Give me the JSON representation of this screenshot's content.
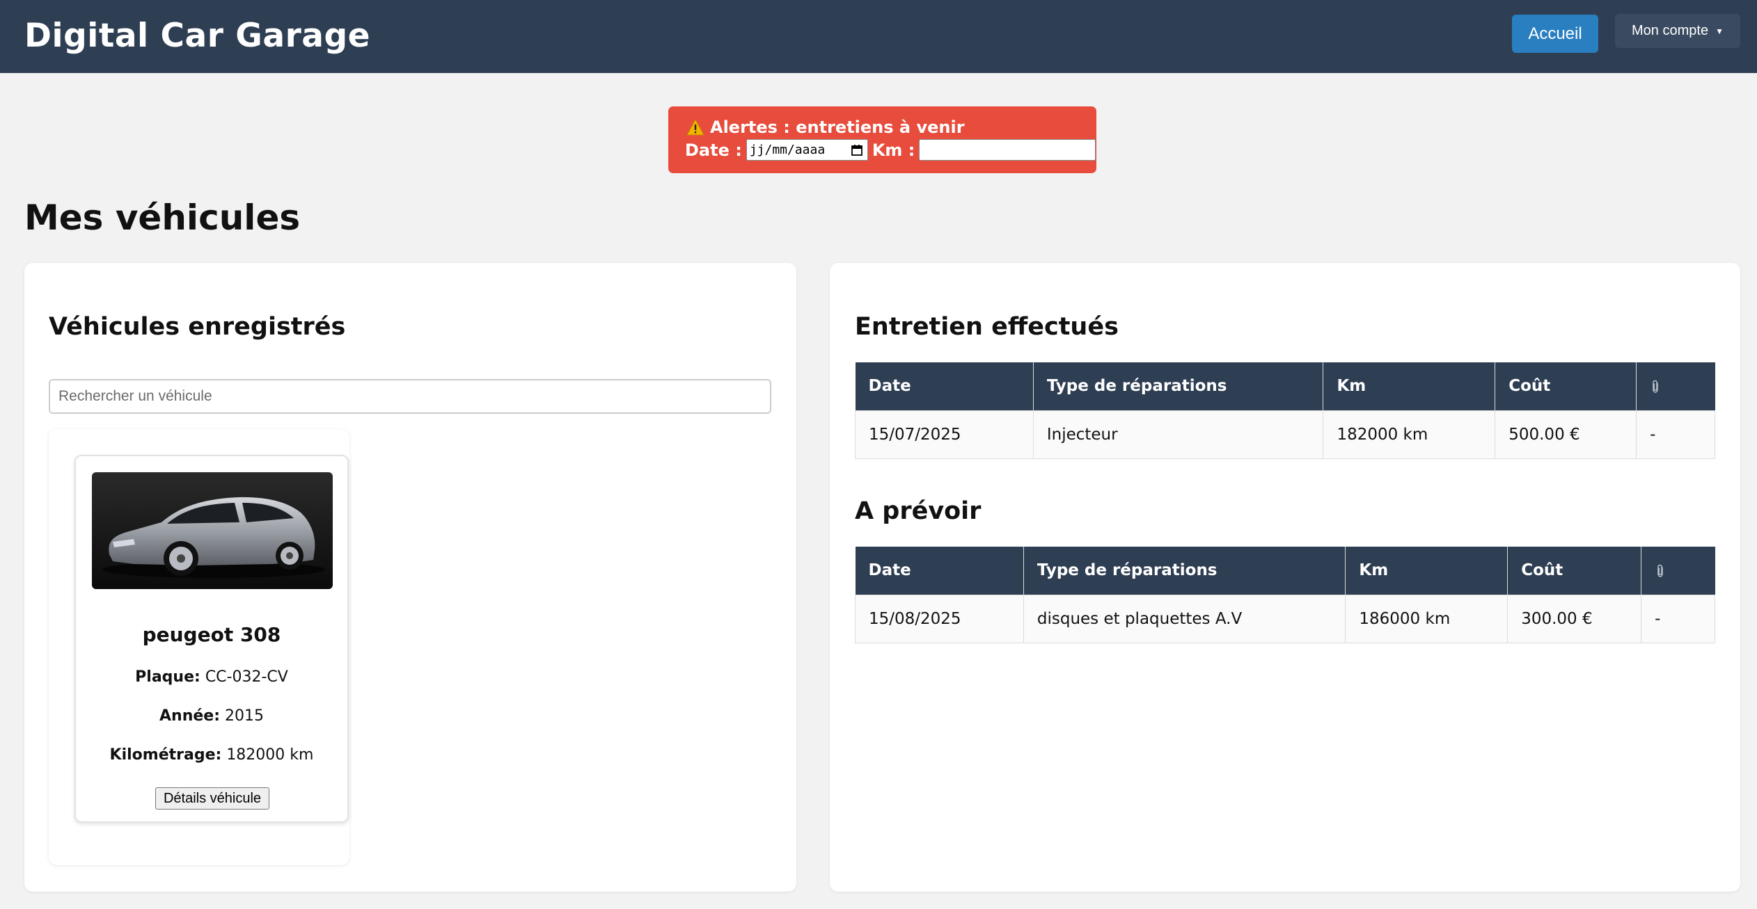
{
  "header": {
    "brand": "Digital Car Garage",
    "home_label": "Accueil",
    "account_label": "Mon compte"
  },
  "alert": {
    "title": "Alertes : entretiens à venir",
    "date_label": "Date :",
    "date_placeholder": "jj/mm/aaaa",
    "km_label": "Km :",
    "km_value": ""
  },
  "page_title": "Mes véhicules",
  "vehicles": {
    "heading": "Véhicules enregistrés",
    "search_placeholder": "Rechercher un véhicule",
    "items": [
      {
        "name": "peugeot 308",
        "plate_label": "Plaque:",
        "plate": "CC-032-CV",
        "year_label": "Année:",
        "year": "2015",
        "km_label": "Kilométrage:",
        "km": "182000 km",
        "details_label": "Détails véhicule"
      }
    ]
  },
  "maintenance_done": {
    "heading": "Entretien effectués",
    "columns": [
      "Date",
      "Type de réparations",
      "Km",
      "Coût"
    ],
    "attachment_icon": "paperclip-icon",
    "rows": [
      {
        "date": "15/07/2025",
        "type": "Injecteur",
        "km": "182000 km",
        "cost": "500.00 €",
        "attachment": "-"
      }
    ]
  },
  "maintenance_planned": {
    "heading": "A prévoir",
    "columns": [
      "Date",
      "Type de réparations",
      "Km",
      "Coût"
    ],
    "attachment_icon": "paperclip-icon",
    "rows": [
      {
        "date": "15/08/2025",
        "type": "disques et plaquettes A.V",
        "km": "186000 km",
        "cost": "300.00 €",
        "attachment": "-"
      }
    ]
  },
  "colors": {
    "header_bg": "#2e3e53",
    "primary_button": "#2a7fc1",
    "alert_bg": "#e74c3c",
    "page_bg": "#f2f2f2"
  }
}
